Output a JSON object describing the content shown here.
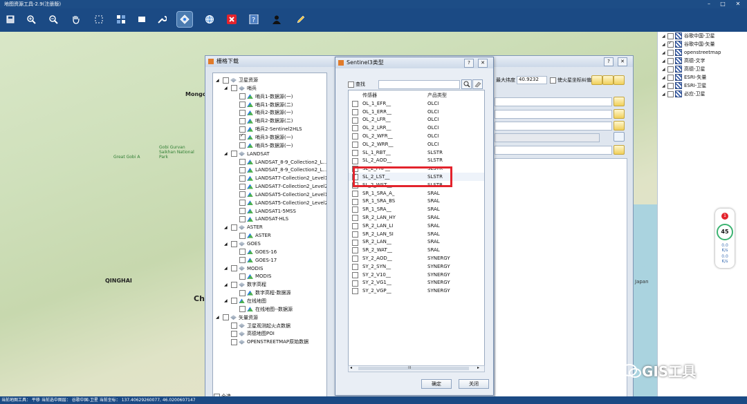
{
  "window": {
    "title": "地图资源工具-2.9(注册版)"
  },
  "toolbar": {
    "icons": [
      "save-icon",
      "zoom-in-icon",
      "zoom-out-icon",
      "pan-hand-icon",
      "select-icon",
      "tiles-icon",
      "clear-icon",
      "tools-icon",
      "download-icon",
      "globe-icon",
      "close-icon",
      "help-icon",
      "user-icon",
      "pencil-icon"
    ]
  },
  "map": {
    "labels": [
      "Mongolia",
      "QINGHAI",
      "Chi",
      "Japan",
      "Gobi Gurvan Saikhan National Park",
      "Great Gobi A"
    ]
  },
  "layers": [
    {
      "label": "谷歌中国-卫星",
      "checked": false
    },
    {
      "label": "谷歌中国-矢量",
      "checked": true
    },
    {
      "label": "openstreetmap",
      "checked": false
    },
    {
      "label": "高德-文字",
      "checked": false
    },
    {
      "label": "高德-卫星",
      "checked": false
    },
    {
      "label": "ESRI-矢量",
      "checked": false
    },
    {
      "label": "ESRI-卫星",
      "checked": false
    },
    {
      "label": "必应-卫星",
      "checked": false
    }
  ],
  "speed_widget": {
    "badge": "1",
    "percent": "45",
    "up": "0.0",
    "down": "0.0",
    "unit": "K/s"
  },
  "status": {
    "text": "当前地图工具： 平移   当前选中图层： 谷歌中国-卫星   当前坐标： 137.40629260077, 46.0200607147"
  },
  "back_dialog": {
    "title": "栅格下载",
    "help": "?",
    "close": "✕",
    "select_all": "全选",
    "field_label": "最大纬度",
    "field_value": "40.9232",
    "option_label": "使火星坐标纠偏",
    "tree": [
      {
        "label": "卫星资源",
        "level": 0,
        "expander": "◢",
        "icon": "sat"
      },
      {
        "label": "哨兵",
        "level": 1,
        "expander": "◢",
        "icon": "sat"
      },
      {
        "label": "哨兵1-数据源(一)",
        "level": 2,
        "icon": "data"
      },
      {
        "label": "哨兵1-数据源(二)",
        "level": 2,
        "icon": "data"
      },
      {
        "label": "哨兵2-数据源(一)",
        "level": 2,
        "icon": "data"
      },
      {
        "label": "哨兵2-数据源(二)",
        "level": 2,
        "icon": "data"
      },
      {
        "label": "哨兵2-Sentinel2HLS",
        "level": 2,
        "icon": "data"
      },
      {
        "label": "哨兵3-数据源(一)",
        "level": 2,
        "icon": "data",
        "checked": true
      },
      {
        "label": "哨兵5-数据源(一)",
        "level": 2,
        "icon": "data"
      },
      {
        "label": "LANDSAT",
        "level": 1,
        "expander": "◢",
        "icon": "sat"
      },
      {
        "label": "LANDSAT_8-9_Collection2_L...",
        "level": 2,
        "icon": "data"
      },
      {
        "label": "LANDSAT_8-9_Collection2_L...",
        "level": 2,
        "icon": "data"
      },
      {
        "label": "LANDSAT7-Collection2_Level1",
        "level": 2,
        "icon": "data"
      },
      {
        "label": "LANDSAT7-Collection2_Level2",
        "level": 2,
        "icon": "data"
      },
      {
        "label": "LANDSAT5-Collection2_Level1",
        "level": 2,
        "icon": "data"
      },
      {
        "label": "LANDSAT5-Collection2_Level2",
        "level": 2,
        "icon": "data"
      },
      {
        "label": "LANDSAT1-5MSS",
        "level": 2,
        "icon": "data"
      },
      {
        "label": "LANDSAT-HLS",
        "level": 2,
        "icon": "data"
      },
      {
        "label": "ASTER",
        "level": 1,
        "expander": "◢",
        "icon": "sat"
      },
      {
        "label": "ASTER",
        "level": 2,
        "icon": "data"
      },
      {
        "label": "GOES",
        "level": 1,
        "expander": "◢",
        "icon": "sat"
      },
      {
        "label": "GOES-16",
        "level": 2,
        "icon": "data"
      },
      {
        "label": "GOES-17",
        "level": 2,
        "icon": "data"
      },
      {
        "label": "MODIS",
        "level": 1,
        "expander": "◢",
        "icon": "sat"
      },
      {
        "label": "MODIS",
        "level": 2,
        "icon": "data"
      },
      {
        "label": "数字高程",
        "level": 1,
        "expander": "◢",
        "icon": "sat"
      },
      {
        "label": "数字高程-数据源",
        "level": 2,
        "icon": "data"
      },
      {
        "label": "在线地图",
        "level": 1,
        "expander": "◢",
        "icon": "data"
      },
      {
        "label": "在线地图--数据源",
        "level": 2,
        "icon": "data"
      },
      {
        "label": "矢量资源",
        "level": 0,
        "expander": "◢",
        "icon": "sat"
      },
      {
        "label": "卫星观测起火点数据",
        "level": 1,
        "icon": "sat"
      },
      {
        "label": "高德地图POI",
        "level": 1,
        "icon": "sat"
      },
      {
        "label": "OPENSTREETMAP原始数据",
        "level": 1,
        "icon": "sat"
      }
    ]
  },
  "dialog": {
    "title": "Sentinel3类型",
    "help": "?",
    "close": "✕",
    "search_label": "查找",
    "search_value": "",
    "col_sensor": "传感器",
    "col_product": "产品类型",
    "rows": [
      {
        "sensor": "OL_1_EFR__",
        "product": "OLCI"
      },
      {
        "sensor": "OL_1_ERR__",
        "product": "OLCI"
      },
      {
        "sensor": "OL_2_LFR__",
        "product": "OLCI"
      },
      {
        "sensor": "OL_2_LRR__",
        "product": "OLCI"
      },
      {
        "sensor": "OL_2_WFR__",
        "product": "OLCI"
      },
      {
        "sensor": "OL_2_WRR__",
        "product": "OLCI"
      },
      {
        "sensor": "SL_1_RBT__",
        "product": "SLSTR"
      },
      {
        "sensor": "SL_2_AOD__",
        "product": "SLSTR"
      },
      {
        "sensor": "SL_2_FRP__",
        "product": "SLSTR"
      },
      {
        "sensor": "SL_2_LST__",
        "product": "SLSTR",
        "checked": true
      },
      {
        "sensor": "SL_2_WST__",
        "product": "SLSTR"
      },
      {
        "sensor": "SR_1_SRA_A_",
        "product": "SRAL"
      },
      {
        "sensor": "SR_1_SRA_BS",
        "product": "SRAL"
      },
      {
        "sensor": "SR_1_SRA__",
        "product": "SRAL"
      },
      {
        "sensor": "SR_2_LAN_HY",
        "product": "SRAL"
      },
      {
        "sensor": "SR_2_LAN_LI",
        "product": "SRAL"
      },
      {
        "sensor": "SR_2_LAN_SI",
        "product": "SRAL"
      },
      {
        "sensor": "SR_2_LAN__",
        "product": "SRAL"
      },
      {
        "sensor": "SR_2_WAT__",
        "product": "SRAL"
      },
      {
        "sensor": "SY_2_AOD__",
        "product": "SYNERGY"
      },
      {
        "sensor": "SY_2_SYN__",
        "product": "SYNERGY"
      },
      {
        "sensor": "SY_2_V10__",
        "product": "SYNERGY"
      },
      {
        "sensor": "SY_2_VG1__",
        "product": "SYNERGY"
      },
      {
        "sensor": "SY_2_VGP__",
        "product": "SYNERGY"
      }
    ],
    "ok": "确定",
    "close_btn": "关闭",
    "scroll_mark": "III"
  },
  "watermark": {
    "text": "GIS工具"
  }
}
